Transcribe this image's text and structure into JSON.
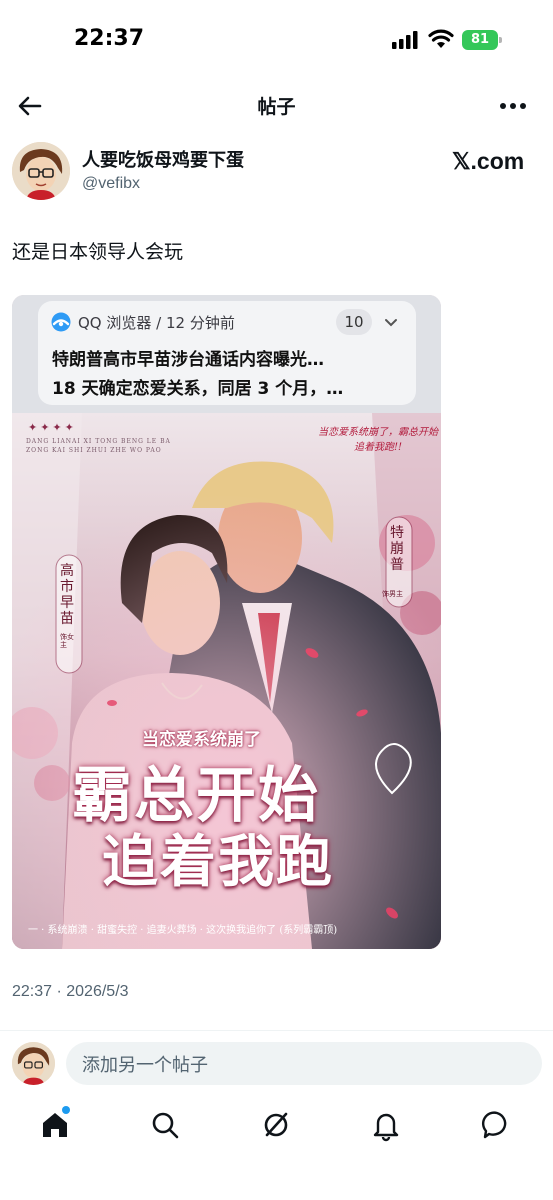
{
  "status_bar": {
    "time": "22:37",
    "battery": "81"
  },
  "header": {
    "title": "帖子"
  },
  "author": {
    "display_name": "人要吃饭母鸡要下蛋",
    "handle": "@vefibx",
    "source": "𝕏.com"
  },
  "post": {
    "text": "还是日本领导人会玩",
    "timestamp": "22:37 · 2026/5/3"
  },
  "image": {
    "notification": {
      "app": "QQ 浏览器 / 12 分钟前",
      "count": "10",
      "line1": "特朗普高市早苗涉台通话内容曝光…",
      "line2": "18 天确定恋爱关系，同居 3 个月，…"
    },
    "poster": {
      "corner_marks": "✦✦✦✦",
      "pinyin": "DANG LIANAI XI TONG BENG LE BA ZONG KAI SHI ZHUI ZHE WO PAO",
      "top_quote": "当恋爱系统崩了，霸总开始追着我跑!!",
      "left_label": "高市早苗",
      "left_sub": "饰女主",
      "right_label": "特崩普",
      "right_sub": "饰男主",
      "banner": "当恋爱系统崩了",
      "title_line1": "霸总开始",
      "title_line2": "追着我跑",
      "tagline": "一 · 系统崩溃 · 甜蜜失控 · 追妻火葬场 · 这次换我追你了 (系列霸霸顶)"
    }
  },
  "reply": {
    "placeholder": "添加另一个帖子"
  },
  "colors": {
    "accent": "#1d9bf0",
    "text": "#0f1419",
    "secondary": "#536471",
    "battery": "#34c759"
  },
  "nav": {
    "items": [
      "home-icon",
      "search-icon",
      "grok-icon",
      "notifications-icon",
      "messages-icon"
    ]
  }
}
